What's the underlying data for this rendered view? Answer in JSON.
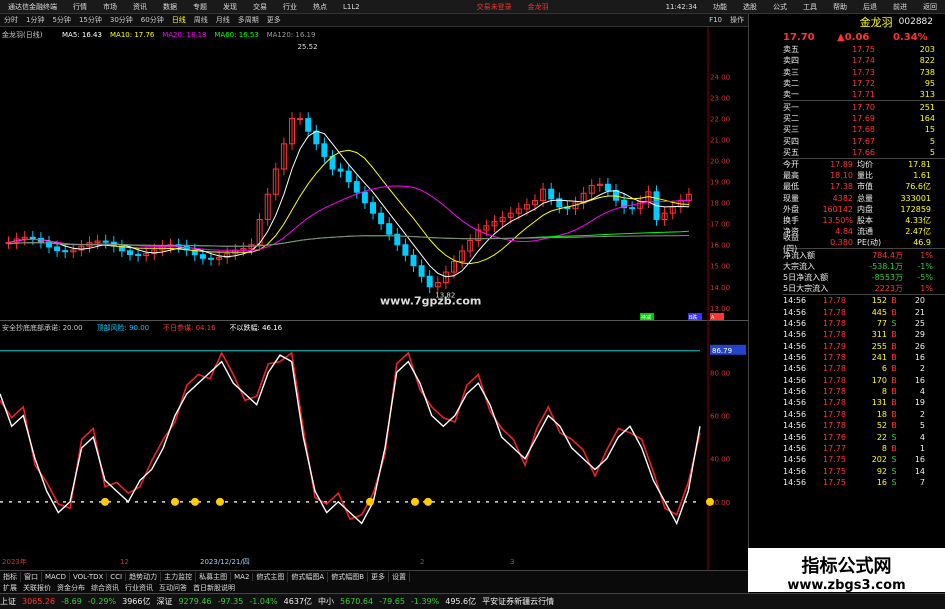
{
  "menubar": {
    "items": [
      "通达信金融终端",
      "行情",
      "市场",
      "资讯",
      "数据",
      "专题",
      "发现",
      "交易",
      "行业",
      "热点",
      "L1L2"
    ],
    "center": "交易未登录",
    "center2": "金龙羽",
    "right_items": [
      "功能",
      "选股",
      "公式",
      "工具",
      "帮助"
    ],
    "time": "11:42:34",
    "window_btns": [
      "后退",
      "前进",
      "返回"
    ]
  },
  "periodbar": {
    "items": [
      "分时",
      "1分钟",
      "5分钟",
      "15分钟",
      "30分钟",
      "60分钟",
      "日线",
      "周线",
      "月线",
      "多周期",
      "更多"
    ],
    "active": "日线",
    "right_items": [
      "F10",
      "操作"
    ]
  },
  "main_chart": {
    "legend": "金龙羽(日线)",
    "ma": [
      {
        "label": "MA5: 16.43",
        "color": "#ffffff"
      },
      {
        "label": "MA10: 17.76",
        "color": "#ffff00"
      },
      {
        "label": "MA20: 18.18",
        "color": "#ff00ff"
      },
      {
        "label": "MA60: 16.53",
        "color": "#00ff00"
      },
      {
        "label": "MA120: 16.19",
        "color": "#999999"
      }
    ],
    "peak_label": "25.52",
    "low_label": "13.82",
    "watermark": "www.7gpzb.com",
    "y_ticks": [
      "24.00",
      "23.00",
      "22.00",
      "21.00",
      "20.00",
      "19.00",
      "18.00",
      "17.00",
      "16.00",
      "15.00",
      "14.00",
      "13.00"
    ],
    "marks": [
      "持减",
      "B跌",
      "A"
    ]
  },
  "sub_chart": {
    "legend": [
      {
        "text": "安全抄底",
        "color": "#cccccc"
      },
      {
        "text": "底部承诺: 20.00",
        "color": "#cccccc"
      },
      {
        "text": "顶部风险: 90.00",
        "color": "#00ccff"
      },
      {
        "text": "不日参谋: 04.16",
        "color": "#ff3333"
      },
      {
        "text": "不以跌幅: 46.16",
        "color": "#ffffff"
      }
    ],
    "top_value": "86.79",
    "y_ticks": [
      "80.00",
      "60.00",
      "40.00",
      "20.00"
    ],
    "dates": [
      "2023年",
      "12",
      "2023/12/21/四",
      "2",
      "3"
    ]
  },
  "tabs1": [
    "指标",
    "窗口",
    "MACD",
    "VOL-TDX",
    "CCI",
    "趋势动力",
    "主力监控",
    "私募主图",
    "MA2",
    "俯式主图",
    "俯式幅图A",
    "俯式幅图B",
    "更多",
    "设置"
  ],
  "tabs2": [
    "扩展",
    "关联报价",
    "资金分布",
    "综合资讯",
    "行业资讯",
    "互动问答",
    "首日新股说明"
  ],
  "statusbar": {
    "items": [
      {
        "text": "上证",
        "cls": "wh"
      },
      {
        "text": "3065.26",
        "cls": "up"
      },
      {
        "text": "-8.69",
        "cls": "dn"
      },
      {
        "text": "-0.29%",
        "cls": "dn"
      },
      {
        "text": "3966亿",
        "cls": "wh"
      },
      {
        "text": "深证",
        "cls": "wh"
      },
      {
        "text": "9279.46",
        "cls": "dn"
      },
      {
        "text": "-97.35",
        "cls": "dn"
      },
      {
        "text": "-1.04%",
        "cls": "dn"
      },
      {
        "text": "4637亿",
        "cls": "wh"
      },
      {
        "text": "中小",
        "cls": "wh"
      },
      {
        "text": "5670.64",
        "cls": "dn"
      },
      {
        "text": "-79.65",
        "cls": "dn"
      },
      {
        "text": "-1.39%",
        "cls": "dn"
      },
      {
        "text": "495.6亿",
        "cls": "wh"
      },
      {
        "text": "平安证券新疆云行情",
        "cls": "wh"
      }
    ]
  },
  "quote": {
    "name": "金龙羽",
    "code": "002882",
    "price": "17.70",
    "change": "▲0.06",
    "pct": "0.34%",
    "asks": [
      {
        "label": "卖五",
        "price": "17.75",
        "vol": "203"
      },
      {
        "label": "卖四",
        "price": "17.74",
        "vol": "822"
      },
      {
        "label": "卖三",
        "price": "17.73",
        "vol": "738"
      },
      {
        "label": "卖二",
        "price": "17.72",
        "vol": "95"
      },
      {
        "label": "卖一",
        "price": "17.71",
        "vol": "313"
      }
    ],
    "bids": [
      {
        "label": "买一",
        "price": "17.70",
        "vol": "251"
      },
      {
        "label": "买二",
        "price": "17.69",
        "vol": "164"
      },
      {
        "label": "买三",
        "price": "17.68",
        "vol": "15"
      },
      {
        "label": "买四",
        "price": "17.67",
        "vol": "5"
      },
      {
        "label": "买五",
        "price": "17.66",
        "vol": "5"
      }
    ],
    "info": [
      {
        "a": "今开",
        "b": "17.89",
        "c": "均价",
        "d": "17.81"
      },
      {
        "a": "最高",
        "b": "18.10",
        "c": "量比",
        "d": "1.61"
      },
      {
        "a": "最低",
        "b": "17.38",
        "c": "市值",
        "d": "76.6亿"
      },
      {
        "a": "现量",
        "b": "4382",
        "c": "总量",
        "d": "333001"
      },
      {
        "a": "外盘",
        "b": "160142",
        "c": "内盘",
        "d": "172859"
      },
      {
        "a": "换手",
        "b": "13.50%",
        "c": "股本",
        "d": "4.33亿"
      },
      {
        "a": "净资",
        "b": "4.84",
        "c": "流通",
        "d": "2.47亿"
      },
      {
        "a": "收益(四)",
        "b": "0.380",
        "c": "PE(动)",
        "d": "46.9"
      }
    ],
    "flows": [
      {
        "a": "净流入额",
        "b": "784.4万",
        "d": "1%"
      },
      {
        "a": "大宗流入",
        "b": "-538.1万",
        "d": "-1%"
      },
      {
        "a": "5日净流入额",
        "b": "-8553万",
        "d": "-5%"
      },
      {
        "a": "5日大宗流入",
        "b": "2223万",
        "d": "1%"
      }
    ],
    "ticks": [
      {
        "t": "14:56",
        "p": "17.78",
        "v": "152",
        "bs": "B",
        "n": "20"
      },
      {
        "t": "14:56",
        "p": "17.78",
        "v": "445",
        "bs": "B",
        "n": "21"
      },
      {
        "t": "14:56",
        "p": "17.78",
        "v": "77",
        "bs": "S",
        "n": "25"
      },
      {
        "t": "14:56",
        "p": "17.78",
        "v": "311",
        "bs": "B",
        "n": "29"
      },
      {
        "t": "14:56",
        "p": "17.79",
        "v": "255",
        "bs": "B",
        "n": "26"
      },
      {
        "t": "14:56",
        "p": "17.78",
        "v": "241",
        "bs": "B",
        "n": "16"
      },
      {
        "t": "14:56",
        "p": "17.78",
        "v": "6",
        "bs": "B",
        "n": "2"
      },
      {
        "t": "14:56",
        "p": "17.78",
        "v": "170",
        "bs": "B",
        "n": "16"
      },
      {
        "t": "14:56",
        "p": "17.78",
        "v": "8",
        "bs": "B",
        "n": "4"
      },
      {
        "t": "14:56",
        "p": "17.78",
        "v": "131",
        "bs": "B",
        "n": "19"
      },
      {
        "t": "14:56",
        "p": "17.78",
        "v": "18",
        "bs": "B",
        "n": "2"
      },
      {
        "t": "14:56",
        "p": "17.78",
        "v": "52",
        "bs": "B",
        "n": "5"
      },
      {
        "t": "14:56",
        "p": "17.76",
        "v": "22",
        "bs": "S",
        "n": "4"
      },
      {
        "t": "14:56",
        "p": "17.77",
        "v": "8",
        "bs": "B",
        "n": "1"
      },
      {
        "t": "14:56",
        "p": "17.75",
        "v": "202",
        "bs": "S",
        "n": "16"
      },
      {
        "t": "14:56",
        "p": "17.75",
        "v": "92",
        "bs": "S",
        "n": "14"
      },
      {
        "t": "14:56",
        "p": "17.75",
        "v": "16",
        "bs": "S",
        "n": "7"
      }
    ]
  },
  "site_watermark": "指标公式网",
  "site_url": "www.zbgs3.com",
  "overlay_watermark": "www.zbgs3.com"
}
